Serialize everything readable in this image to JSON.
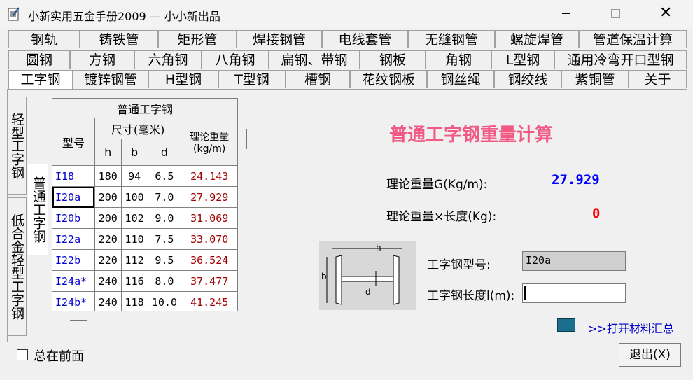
{
  "window": {
    "title": "小新实用五金手册2009 — 小小新出品",
    "close_glyph": "✕"
  },
  "tabs": {
    "row1": [
      "钢轨",
      "铸铁管",
      "矩形管",
      "焊接钢管",
      "电线套管",
      "无缝钢管",
      "螺旋焊管",
      "管道保温计算"
    ],
    "row2": [
      "圆钢",
      "方钢",
      "六角钢",
      "八角钢",
      "扁钢、带钢",
      "钢板",
      "角钢",
      "L型钢",
      "通用冷弯开口型钢"
    ],
    "row3": [
      "工字钢",
      "镀锌钢管",
      "H型钢",
      "T型钢",
      "槽钢",
      "花纹钢板",
      "钢丝绳",
      "钢绞线",
      "紫铜管",
      "关于"
    ]
  },
  "side_tabs": [
    "轻型工字钢",
    "低合金轻型工字钢"
  ],
  "active_side_tab": "普通工字钢",
  "table": {
    "title": "普通工字钢",
    "col_model": "型号",
    "col_dims": "尺寸(毫米)",
    "col_weight": "理论重量(kg/m)",
    "dim_cols": [
      "h",
      "b",
      "d"
    ],
    "rows": [
      [
        "I18",
        "180",
        "94",
        "6.5",
        "24.143"
      ],
      [
        "I20a",
        "200",
        "100",
        "7.0",
        "27.929"
      ],
      [
        "I20b",
        "200",
        "102",
        "9.0",
        "31.069"
      ],
      [
        "I22a",
        "220",
        "110",
        "7.5",
        "33.070"
      ],
      [
        "I22b",
        "220",
        "112",
        "9.5",
        "36.524"
      ],
      [
        "I24a*",
        "240",
        "116",
        "8.0",
        "37.477"
      ],
      [
        "I24b*",
        "240",
        "118",
        "10.0",
        "41.245"
      ]
    ]
  },
  "calc": {
    "title": "普通工字钢重量计算",
    "weight_label": "理论重量G(Kg/m):",
    "weight_value": "27.929",
    "total_label": "理论重量×长度(Kg):",
    "total_value": "0",
    "model_label": "工字钢型号:",
    "model_value": "I20a",
    "length_label": "工字钢长度l(m):",
    "length_value": "",
    "diagram_labels": {
      "h": "h",
      "b": "b",
      "d": "d"
    }
  },
  "link_text": ">>打开材料汇总",
  "always_on_top": "总在前面",
  "exit_button": "退出(X)"
}
